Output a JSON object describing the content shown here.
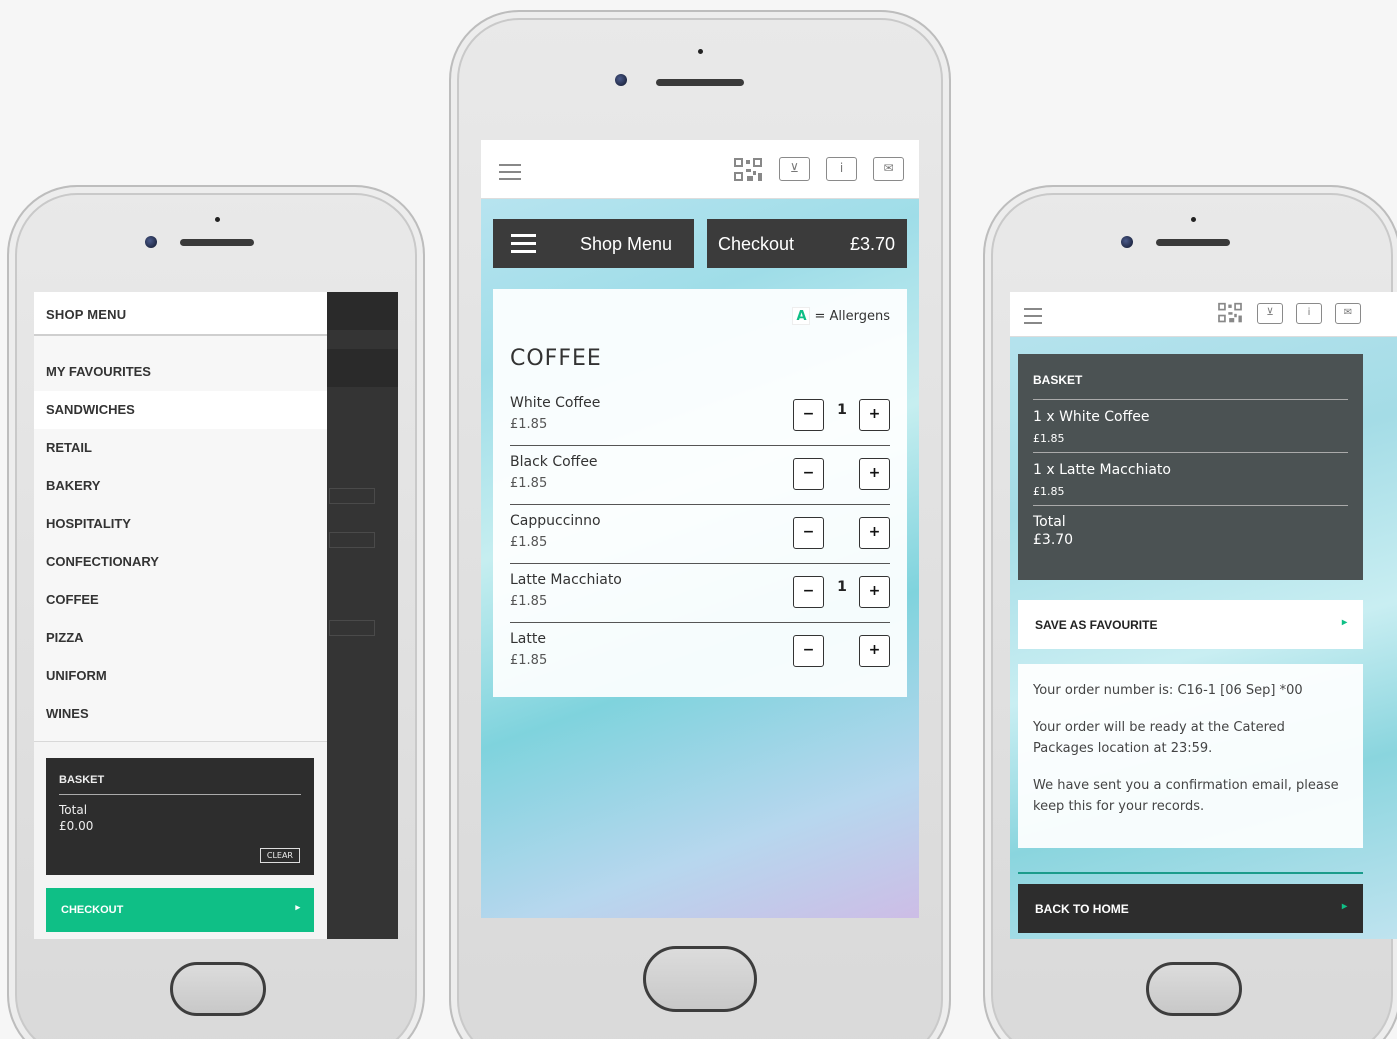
{
  "left": {
    "drawer_title": "SHOP MENU",
    "items": [
      {
        "label": "MY FAVOURITES"
      },
      {
        "label": "SANDWICHES"
      },
      {
        "label": "RETAIL"
      },
      {
        "label": "BAKERY"
      },
      {
        "label": "HOSPITALITY"
      },
      {
        "label": "CONFECTIONARY"
      },
      {
        "label": "COFFEE"
      },
      {
        "label": "PIZZA"
      },
      {
        "label": "UNIFORM"
      },
      {
        "label": "WINES"
      }
    ],
    "basket": {
      "title": "BASKET",
      "total_label": "Total",
      "total_value": "£0.00",
      "clear_label": "CLEAR"
    },
    "checkout_label": "CHECKOUT",
    "arrow": "▸"
  },
  "center": {
    "shop_menu_label": "Shop Menu",
    "checkout_label": "Checkout",
    "checkout_amount": "£3.70",
    "allergen_key": {
      "letter": "A",
      "text": "= Allergens"
    },
    "category": "COFFEE",
    "products": [
      {
        "name": "White Coffee",
        "price": "£1.85",
        "qty": "1"
      },
      {
        "name": "Black Coffee",
        "price": "£1.85",
        "qty": ""
      },
      {
        "name": "Cappuccinno",
        "price": "£1.85",
        "qty": ""
      },
      {
        "name": "Latte Macchiato",
        "price": "£1.85",
        "qty": "1"
      },
      {
        "name": "Latte",
        "price": "£1.85",
        "qty": ""
      }
    ],
    "minus": "−",
    "plus": "+"
  },
  "right": {
    "basket": {
      "title": "BASKET",
      "lines": [
        {
          "name": "1 x White Coffee",
          "price": "£1.85"
        },
        {
          "name": "1 x Latte Macchiato",
          "price": "£1.85"
        }
      ],
      "total_label": "Total",
      "total_value": "£3.70"
    },
    "save_fav_label": "SAVE AS FAVOURITE",
    "confirmation": {
      "order_number": "Your order number is: C16-1 [06 Sep] *00",
      "ready": "Your order will be ready at the Catered Packages location at 23:59.",
      "email": "We have sent you a confirmation email, please keep this for your records."
    },
    "back_home_label": "BACK TO HOME",
    "arrow": "▸"
  },
  "icons": {
    "qr": "qr-code-icon",
    "basket": "basket-icon",
    "info": "info-icon",
    "mail": "mail-icon",
    "menu": "hamburger-menu-icon"
  },
  "colors": {
    "accent": "#0fbf86",
    "dark": "#3b3b3b",
    "basket_panel": "#4b5253"
  }
}
